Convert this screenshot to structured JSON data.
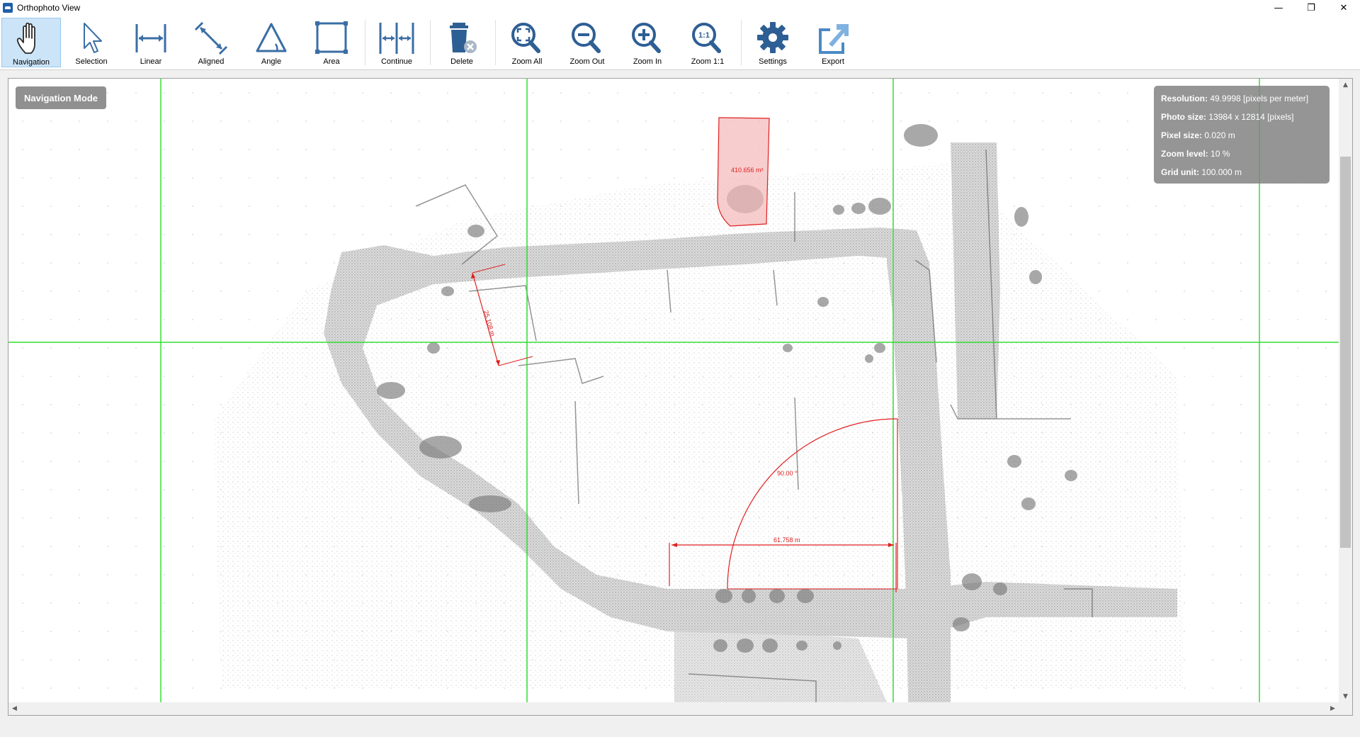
{
  "window": {
    "title": "Orthophoto View",
    "controls": {
      "minimize": "—",
      "restore": "❐",
      "close": "✕"
    }
  },
  "toolbar": {
    "tools": [
      {
        "id": "navigation",
        "label": "Navigation",
        "icon": "hand-icon",
        "active": true
      },
      {
        "id": "selection",
        "label": "Selection",
        "icon": "cursor-arrow-icon"
      },
      {
        "id": "linear",
        "label": "Linear",
        "icon": "linear-measure-icon"
      },
      {
        "id": "aligned",
        "label": "Aligned",
        "icon": "aligned-measure-icon"
      },
      {
        "id": "angle",
        "label": "Angle",
        "icon": "angle-measure-icon"
      },
      {
        "id": "area",
        "label": "Area",
        "icon": "area-measure-icon"
      },
      {
        "id": "continue",
        "label": "Continue",
        "icon": "continue-measure-icon"
      },
      {
        "id": "delete",
        "label": "Delete",
        "icon": "trash-icon"
      },
      {
        "id": "zoom_all",
        "label": "Zoom All",
        "icon": "zoom-all-icon"
      },
      {
        "id": "zoom_out",
        "label": "Zoom Out",
        "icon": "zoom-out-icon"
      },
      {
        "id": "zoom_in",
        "label": "Zoom In",
        "icon": "zoom-in-icon"
      },
      {
        "id": "zoom_1_1",
        "label": "Zoom 1:1",
        "icon": "zoom-1-1-icon"
      },
      {
        "id": "settings",
        "label": "Settings",
        "icon": "gear-icon"
      },
      {
        "id": "export",
        "label": "Export",
        "icon": "export-icon"
      }
    ]
  },
  "view": {
    "mode": "Navigation Mode",
    "info": {
      "resolution_label": "Resolution:",
      "resolution_value": "49.9998 [pixels per meter]",
      "photo_size_label": "Photo size:",
      "photo_size_value": "13984 x 12814 [pixels]",
      "pixel_size_label": "Pixel size:",
      "pixel_size_value": "0.020 m",
      "zoom_level_label": "Zoom level:",
      "zoom_level_value": "10 %",
      "grid_unit_label": "Grid unit:",
      "grid_unit_value": "100.000 m"
    },
    "measurements": {
      "area": "410.656 m²",
      "aligned": "25.108 m",
      "angle": "90.00 °",
      "linear": "61.758 m"
    },
    "colors": {
      "grid": "#33dd33",
      "measurement": "#e02020",
      "area_fill": "#f4b8b8",
      "point_cloud": "#9a9a9a"
    }
  }
}
